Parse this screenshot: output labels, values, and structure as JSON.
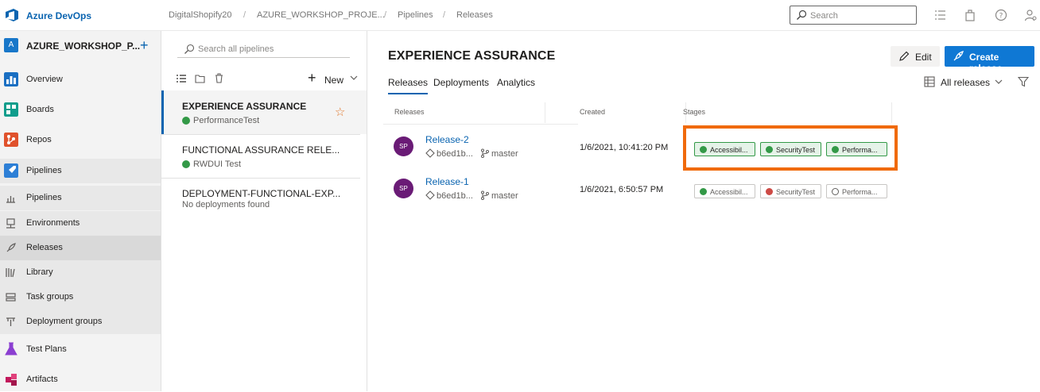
{
  "header": {
    "brand": "Azure DevOps",
    "breadcrumbs": [
      "DigitalShopify20",
      "AZURE_WORKSHOP_PROJE...",
      "Pipelines",
      "Releases"
    ],
    "search_placeholder": "Search"
  },
  "sidebar": {
    "project_initial": "A",
    "project_name": "AZURE_WORKSHOP_P...",
    "items": [
      {
        "label": "Overview",
        "icon": "overview-icon"
      },
      {
        "label": "Boards",
        "icon": "boards-icon"
      },
      {
        "label": "Repos",
        "icon": "repos-icon"
      },
      {
        "label": "Pipelines",
        "icon": "pipelines-icon"
      },
      {
        "label": "Pipelines",
        "icon": "pipelines-sub-icon"
      },
      {
        "label": "Environments",
        "icon": "environments-icon"
      },
      {
        "label": "Releases",
        "icon": "releases-icon"
      },
      {
        "label": "Library",
        "icon": "library-icon"
      },
      {
        "label": "Task groups",
        "icon": "task-groups-icon"
      },
      {
        "label": "Deployment groups",
        "icon": "deployment-groups-icon"
      },
      {
        "label": "Test Plans",
        "icon": "test-plans-icon"
      },
      {
        "label": "Artifacts",
        "icon": "artifacts-icon"
      }
    ]
  },
  "pipelines_list": {
    "search_placeholder": "Search all pipelines",
    "new_label": "New",
    "items": [
      {
        "name": "EXPERIENCE ASSURANCE",
        "status": "PerformanceTest"
      },
      {
        "name": "FUNCTIONAL ASSURANCE RELE...",
        "status": "RWDUI Test"
      },
      {
        "name": "DEPLOYMENT-FUNCTIONAL-EXP...",
        "status": "No deployments found"
      }
    ]
  },
  "main": {
    "title": "EXPERIENCE ASSURANCE",
    "edit_label": "Edit",
    "create_label": "Create release",
    "tabs": [
      "Releases",
      "Deployments",
      "Analytics"
    ],
    "view_filter": "All releases",
    "columns": [
      "Releases",
      "Created",
      "Stages"
    ],
    "releases": [
      {
        "initials": "SP",
        "name": "Release-2",
        "commit": "b6ed1b...",
        "branch": "master",
        "created": "1/6/2021, 10:41:20 PM",
        "stages": [
          {
            "label": "Accessibil...",
            "status": "succeeded"
          },
          {
            "label": "SecurityTest",
            "status": "succeeded"
          },
          {
            "label": "Performa...",
            "status": "succeeded"
          }
        ]
      },
      {
        "initials": "SP",
        "name": "Release-1",
        "commit": "b6ed1b...",
        "branch": "master",
        "created": "1/6/2021, 6:50:57 PM",
        "stages": [
          {
            "label": "Accessibil...",
            "status": "succeeded"
          },
          {
            "label": "SecurityTest",
            "status": "failed"
          },
          {
            "label": "Performa...",
            "status": "not-deployed"
          }
        ]
      }
    ]
  },
  "colors": {
    "accent": "#0a64b0",
    "primary_button": "#0f78d4",
    "success": "#339947",
    "failure": "#cd4a45",
    "highlight": "#f06a0a",
    "avatar": "#6a1b76"
  }
}
